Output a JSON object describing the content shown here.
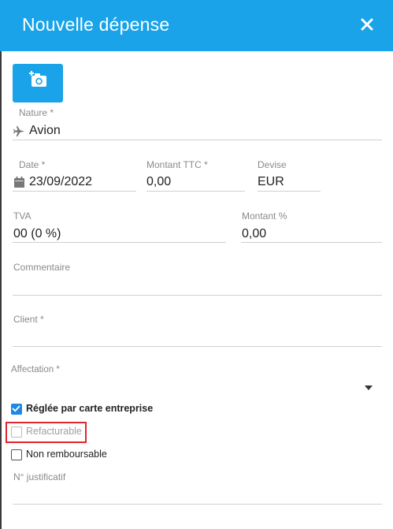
{
  "header": {
    "title": "Nouvelle dépense",
    "close_icon": "close-icon",
    "color": "#1aa3e8"
  },
  "photo_button": {
    "icon": "add-photo-icon"
  },
  "form": {
    "nature": {
      "label": "Nature *",
      "value": "Avion",
      "icon": "airplane-icon"
    },
    "date": {
      "label": "Date *",
      "value": "23/09/2022",
      "icon": "calendar-icon"
    },
    "montant_ttc": {
      "label": "Montant TTC *",
      "value": "0,00"
    },
    "devise": {
      "label": "Devise",
      "value": "EUR"
    },
    "tva": {
      "label": "TVA",
      "value": "00 (0 %)"
    },
    "montant_pct": {
      "label": "Montant %",
      "value": "0,00"
    },
    "commentaire": {
      "label": "Commentaire",
      "value": ""
    },
    "client": {
      "label": "Client *",
      "value": ""
    },
    "affectation": {
      "label": "Affectation *",
      "value": ""
    },
    "justificatif": {
      "label": "N° justificatif",
      "value": ""
    }
  },
  "checkboxes": {
    "reglee": {
      "label": "Réglée par carte entreprise",
      "checked": true
    },
    "refacturable": {
      "label": "Refacturable",
      "checked": false,
      "disabled": true
    },
    "non_remboursable": {
      "label": "Non remboursable",
      "checked": false
    }
  }
}
